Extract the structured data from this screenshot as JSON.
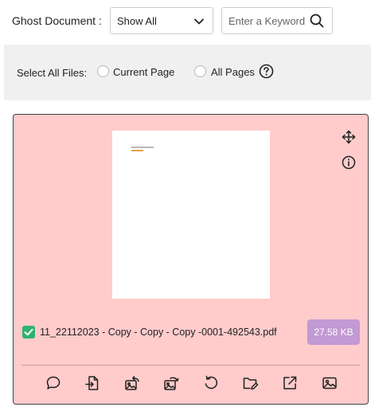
{
  "filter": {
    "label": "Ghost Document :",
    "select_value": "Show All",
    "search_placeholder": "Enter a Keyword",
    "icons": {
      "dropdown": "chevron-down-icon",
      "search": "search-icon"
    }
  },
  "selection": {
    "label": "Select All Files:",
    "options": [
      "Current Page",
      "All Pages"
    ],
    "help_icon": "help-circle-icon"
  },
  "file": {
    "name": "11_22112023 - Copy - Copy - Copy -0001-492543.pdf",
    "size": "27.58 KB",
    "checked": true,
    "card_color": "#ffcbcb",
    "badge_color": "#c299d3",
    "check_color": "#2db36f"
  },
  "actions": [
    "comment-icon",
    "export-file-icon",
    "rotate-image-left-icon",
    "rotate-image-right-icon",
    "undo-icon",
    "rename-folder-icon",
    "open-external-icon",
    "image-icon"
  ]
}
